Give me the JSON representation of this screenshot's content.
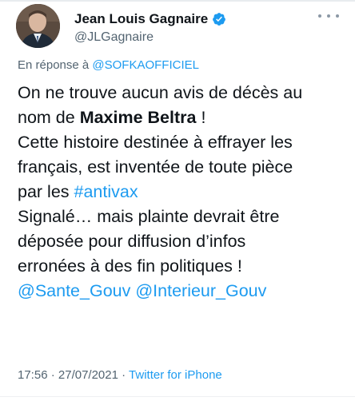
{
  "author": {
    "name": "Jean Louis Gagnaire",
    "handle": "@JLGagnaire"
  },
  "reply": {
    "prefix": "En réponse à",
    "mention": "@SOFKAOFFICIEL"
  },
  "tweet": {
    "l1": "On ne trouve aucun avis de décès au",
    "l2_pre": "nom de ",
    "l2_bold": "Maxime Beltra",
    "l2_post": " !",
    "l3": "Cette histoire destinée à effrayer les",
    "l4": "français, est inventée de toute pièce",
    "l5_pre": "par les ",
    "l5_hashtag": "#antivax",
    "l6": "Signalé… mais plainte devrait être",
    "l7": "déposée pour diffusion d’infos",
    "l8": "erronées à des fin politiques !",
    "mention1": "@Sante_Gouv",
    "mention2": "@Interieur_Gouv"
  },
  "meta": {
    "time": "17:56",
    "sep1": " · ",
    "date": "27/07/2021",
    "sep2": " · ",
    "source": "Twitter for iPhone"
  },
  "colors": {
    "link": "#1d9bf0",
    "secondary": "#536471",
    "text": "#0f1419",
    "verified": "#1d9bf0"
  },
  "icons": [
    "verified-badge-icon",
    "more-options-icon"
  ]
}
